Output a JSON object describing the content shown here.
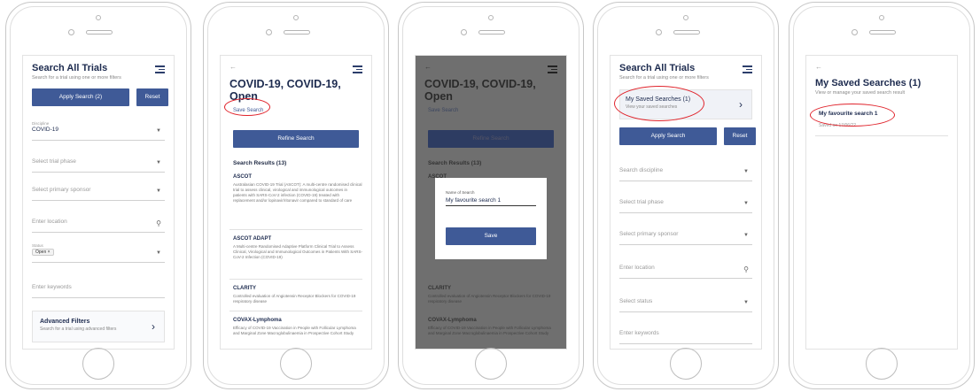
{
  "screen1": {
    "title": "Search All Trials",
    "subtitle": "Search for a trial using one or more filters",
    "apply_button": "Apply Search (2)",
    "reset_button": "Reset",
    "discipline_label": "Discipline",
    "discipline_value": "COVID-19",
    "phase_placeholder": "Select trial phase",
    "sponsor_placeholder": "Select primary sponsor",
    "location_placeholder": "Enter location",
    "status_label": "Status",
    "status_chip": "Open",
    "keywords_placeholder": "Enter keywords",
    "advanced_title": "Advanced Filters",
    "advanced_sub": "Search for a trial using advanced filters"
  },
  "screen2": {
    "back": "←",
    "title": "COVID-19, COVID-19, Open",
    "save_search": "Save Search",
    "refine_button": "Refine Search",
    "results_title": "Search Results (13)",
    "results": [
      {
        "title": "ASCOT",
        "desc": "Australasian COVID-19 Trial (ASCOT): A multi-centre randomised clinical trial to assess clinical, virological and immunological outcomes in patients with SARS-CoV-2 infection (COVID-19) treated with replacement and/or lopinavir/ritonavir compared to standard of care"
      },
      {
        "title": "ASCOT ADAPT",
        "desc": "A Multi-centre Randomised Adaptive Platform Clinical Trial to Assess Clinical, Virological and Immunological Outcomes in Patients With SARS-CoV-2 Infection (COVID-19)"
      },
      {
        "title": "CLARITY",
        "desc": "Controlled evaluation of Angiotensin Receptor Blockers for COVID-19 respiratory disease"
      },
      {
        "title": "COVAX-Lymphoma",
        "desc": "Efficacy of COVID-19 Vaccination in People with Follicular Lymphoma and Marginal Zone Macroglobulinaemia in Prospective Cohort Study"
      }
    ]
  },
  "screen3": {
    "title": "COVID-19, COVID-19, Open",
    "save_search": "Save Search",
    "refine_button": "Refine Search",
    "results_title": "Search Results (13)",
    "peek_title": "ASCOT",
    "modal_label": "Name of Search",
    "modal_value": "My favourite search 1",
    "modal_button": "Save",
    "r_clarity": "CLARITY",
    "r_clarity_desc": "Controlled evaluation of Angiotensin Receptor Blockers for COVID-19 respiratory disease",
    "r_covax": "COVAX-Lymphoma",
    "r_covax_desc": "Efficacy of COVID-19 Vaccination in People with Follicular Lymphoma and Marginal Zone Macroglobulinaemia in Prospective Cohort Study"
  },
  "screen4": {
    "title": "Search All Trials",
    "subtitle": "Search for a trial using one or more filters",
    "saved_title": "My Saved Searches (1)",
    "saved_sub": "View your saved searches",
    "apply_button": "Apply Search",
    "reset_button": "Reset",
    "discipline_placeholder": "Search discipline",
    "phase_placeholder": "Select trial phase",
    "sponsor_placeholder": "Select primary sponsor",
    "location_placeholder": "Enter location",
    "status_placeholder": "Select status",
    "keywords_placeholder": "Enter keywords"
  },
  "screen5": {
    "back": "←",
    "title": "My Saved Searches (1)",
    "subtitle": "View or manage your saved search result",
    "item_title": "My favourite search 1",
    "item_date": "Saved on 17/06/22"
  },
  "colors": {
    "accent": "#3f5a97",
    "annotation": "#e0232b",
    "title": "#1d2b4f"
  }
}
